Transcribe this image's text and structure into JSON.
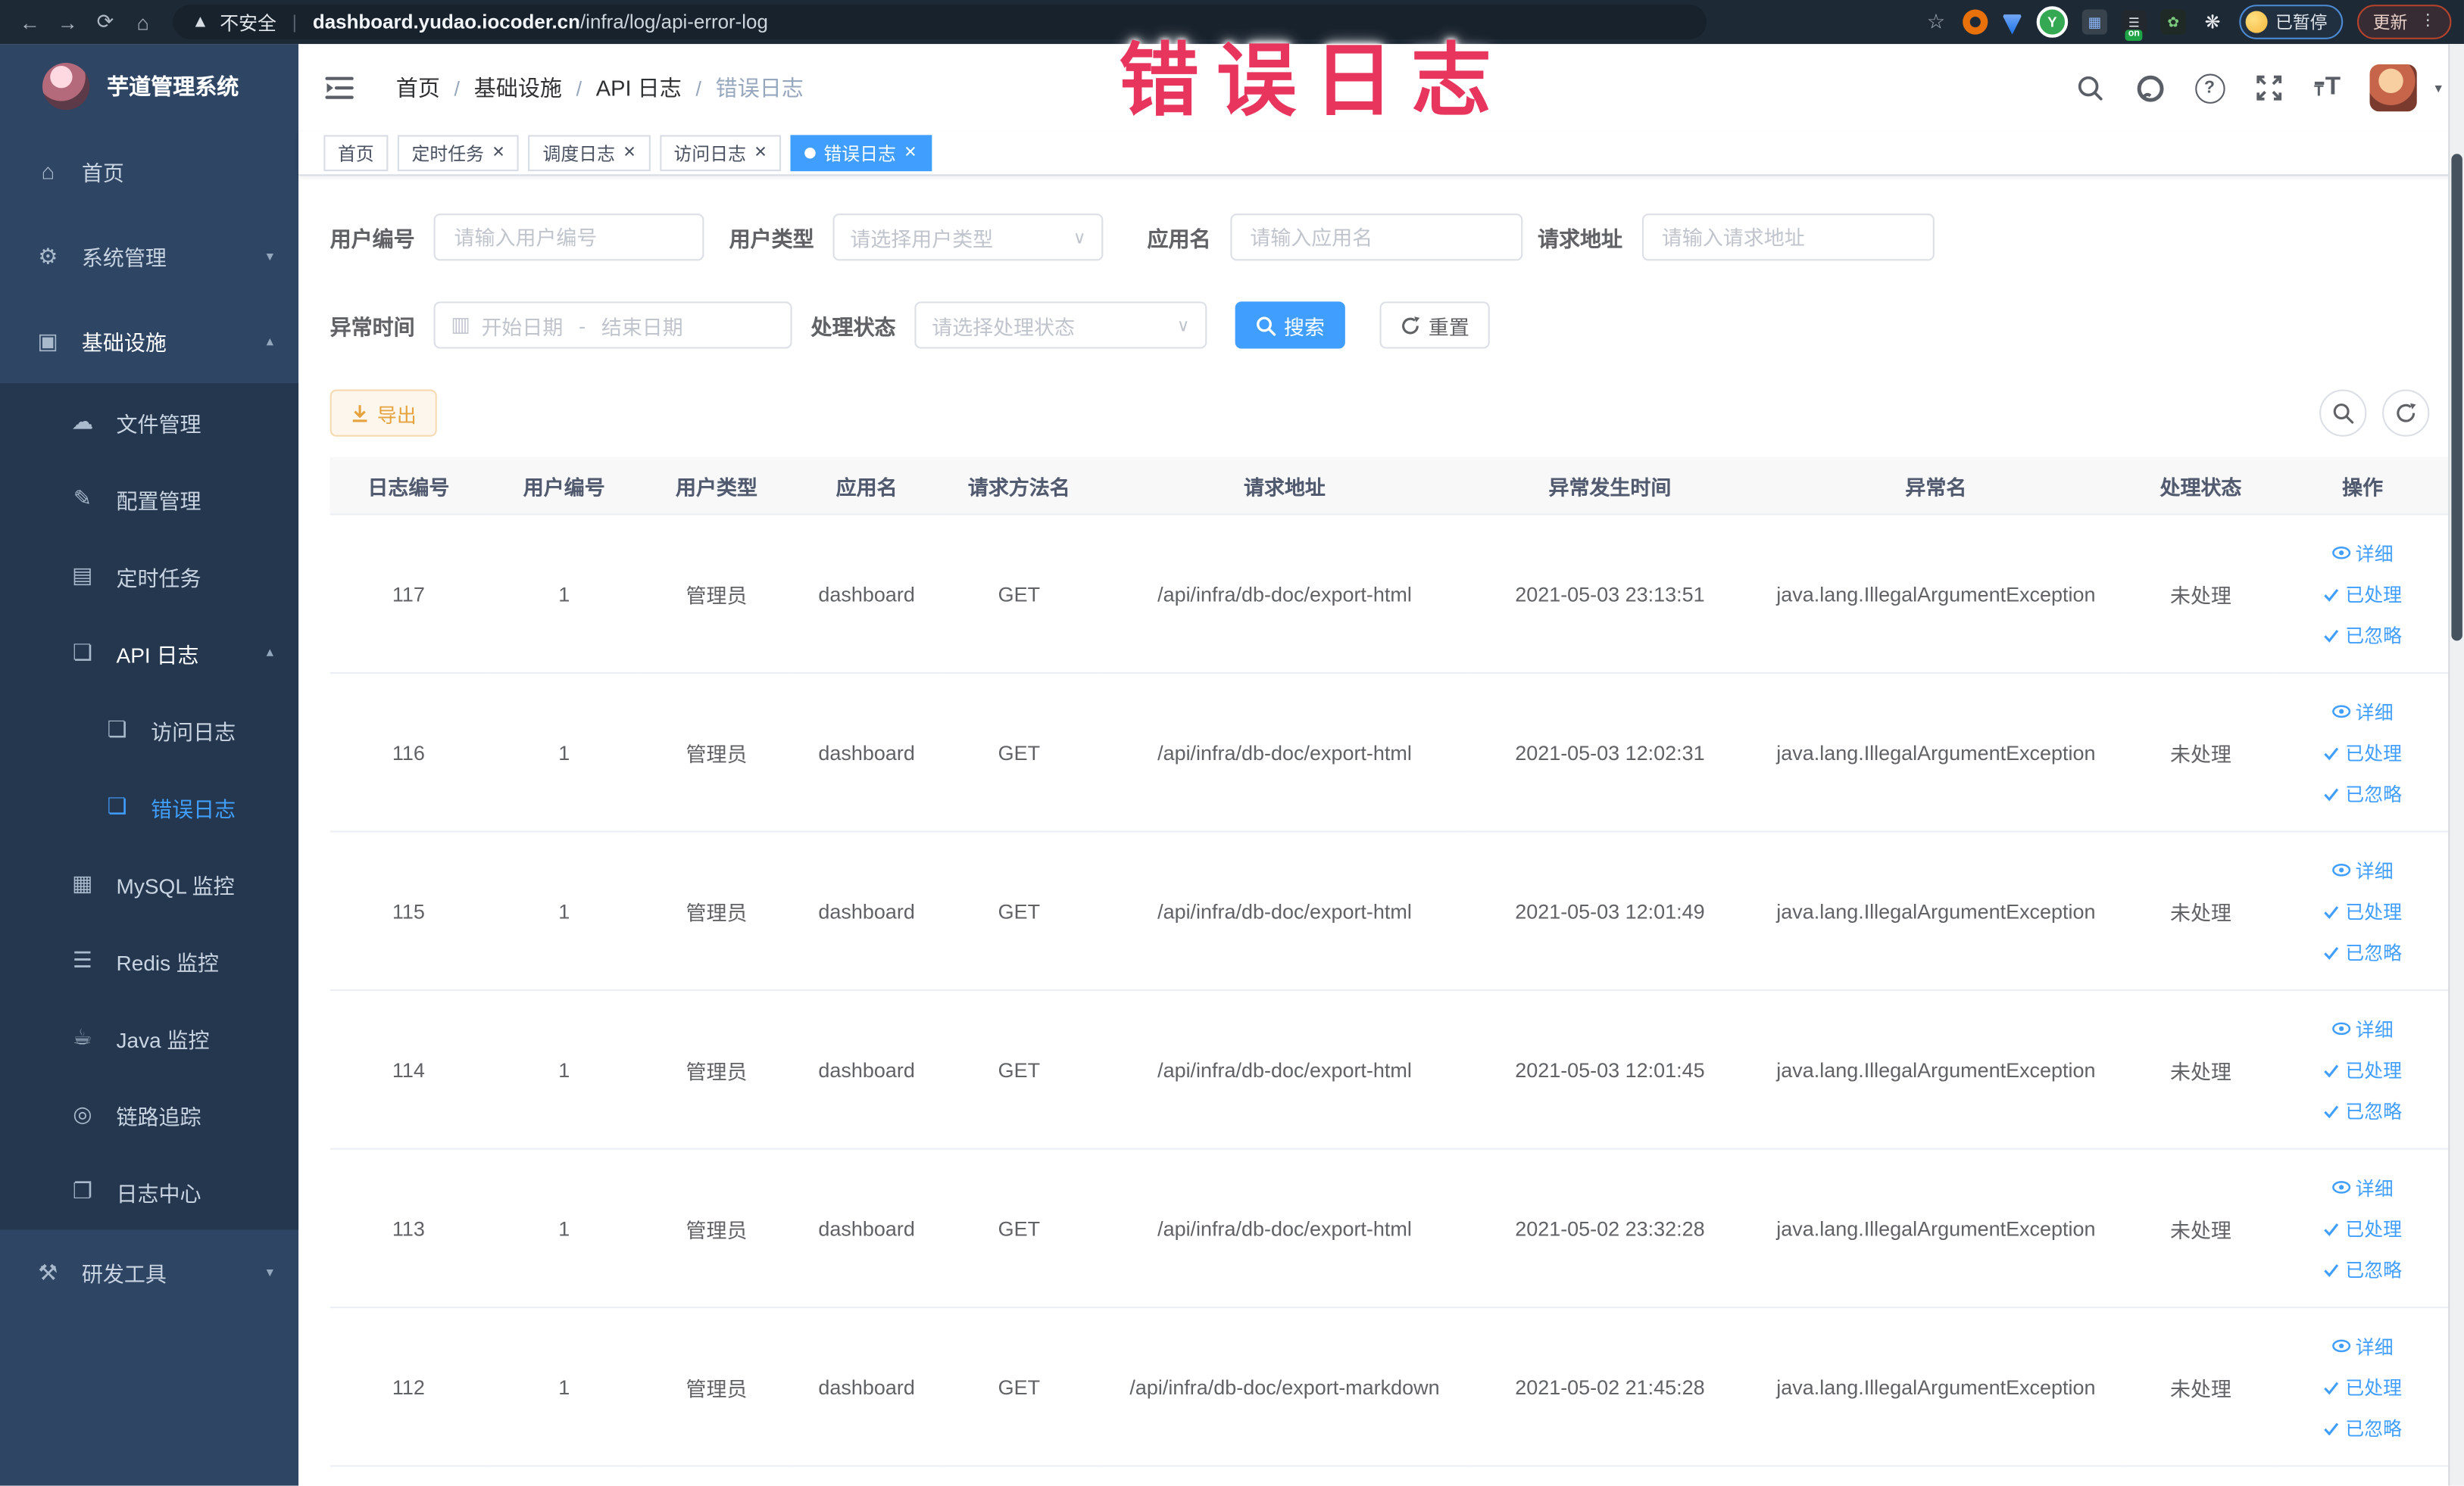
{
  "browser": {
    "security_label": "不安全",
    "url_domain": "dashboard.yudao.iocoder.cn",
    "url_path": "/infra/log/api-error-log",
    "paused_chip": "已暂停",
    "update_label": "更新"
  },
  "annotation": {
    "text": "错误日志"
  },
  "sidebar": {
    "logo_title": "芋道管理系统",
    "items": [
      "首页",
      "系统管理",
      "基础设施",
      "文件管理",
      "配置管理",
      "定时任务",
      "API 日志",
      "访问日志",
      "错误日志",
      "MySQL 监控",
      "Redis 监控",
      "Java 监控",
      "链路追踪",
      "日志中心",
      "研发工具"
    ]
  },
  "header": {
    "breadcrumb": [
      "首页",
      "基础设施",
      "API 日志",
      "错误日志"
    ],
    "separator": "/"
  },
  "tabs": [
    {
      "label": "首页"
    },
    {
      "label": "定时任务"
    },
    {
      "label": "调度日志"
    },
    {
      "label": "访问日志"
    },
    {
      "label": "错误日志"
    }
  ],
  "filters": {
    "user_id": {
      "label": "用户编号",
      "placeholder": "请输入用户编号"
    },
    "user_type": {
      "label": "用户类型",
      "placeholder": "请选择用户类型"
    },
    "app_name": {
      "label": "应用名",
      "placeholder": "请输入应用名"
    },
    "request_url": {
      "label": "请求地址",
      "placeholder": "请输入请求地址"
    },
    "exception_time": {
      "label": "异常时间",
      "start_placeholder": "开始日期",
      "separator": "-",
      "end_placeholder": "结束日期"
    },
    "process_status": {
      "label": "处理状态",
      "placeholder": "请选择处理状态"
    },
    "search_label": "搜索",
    "reset_label": "重置"
  },
  "toolbar": {
    "export_label": "导出"
  },
  "table": {
    "columns": [
      "日志编号",
      "用户编号",
      "用户类型",
      "应用名",
      "请求方法名",
      "请求地址",
      "异常发生时间",
      "异常名",
      "处理状态",
      "操作"
    ],
    "action_detail": "详细",
    "action_processed": "已处理",
    "action_ignored": "已忽略",
    "rows": [
      {
        "log_id": "117",
        "user_id": "1",
        "user_type": "管理员",
        "app_name": "dashboard",
        "method": "GET",
        "url": "/api/infra/db-doc/export-html",
        "time": "2021-05-03 23:13:51",
        "exception": "java.lang.IllegalArgumentException",
        "status": "未处理"
      },
      {
        "log_id": "116",
        "user_id": "1",
        "user_type": "管理员",
        "app_name": "dashboard",
        "method": "GET",
        "url": "/api/infra/db-doc/export-html",
        "time": "2021-05-03 12:02:31",
        "exception": "java.lang.IllegalArgumentException",
        "status": "未处理"
      },
      {
        "log_id": "115",
        "user_id": "1",
        "user_type": "管理员",
        "app_name": "dashboard",
        "method": "GET",
        "url": "/api/infra/db-doc/export-html",
        "time": "2021-05-03 12:01:49",
        "exception": "java.lang.IllegalArgumentException",
        "status": "未处理"
      },
      {
        "log_id": "114",
        "user_id": "1",
        "user_type": "管理员",
        "app_name": "dashboard",
        "method": "GET",
        "url": "/api/infra/db-doc/export-html",
        "time": "2021-05-03 12:01:45",
        "exception": "java.lang.IllegalArgumentException",
        "status": "未处理"
      },
      {
        "log_id": "113",
        "user_id": "1",
        "user_type": "管理员",
        "app_name": "dashboard",
        "method": "GET",
        "url": "/api/infra/db-doc/export-html",
        "time": "2021-05-02 23:32:28",
        "exception": "java.lang.IllegalArgumentException",
        "status": "未处理"
      },
      {
        "log_id": "112",
        "user_id": "1",
        "user_type": "管理员",
        "app_name": "dashboard",
        "method": "GET",
        "url": "/api/infra/db-doc/export-markdown",
        "time": "2021-05-02 21:45:28",
        "exception": "java.lang.IllegalArgumentException",
        "status": "未处理"
      }
    ]
  }
}
